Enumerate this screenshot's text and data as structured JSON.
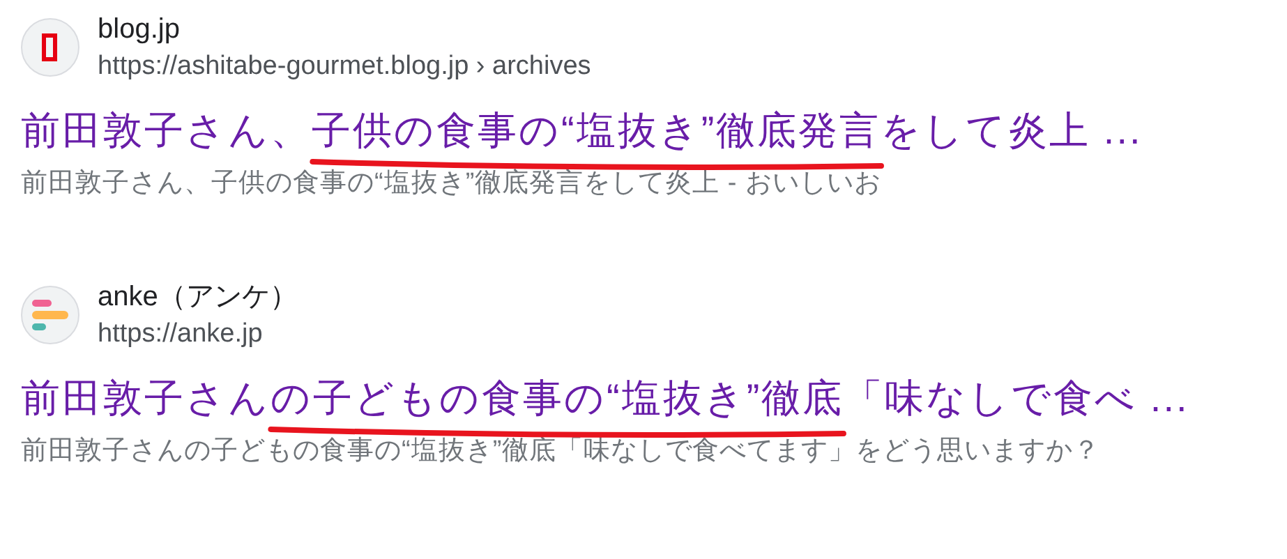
{
  "results": [
    {
      "site_name": "blog.jp",
      "url": "https://ashitabe-gourmet.blog.jp › archives",
      "title_parts": [
        {
          "text": "前田敦子さん、",
          "underlined": false
        },
        {
          "text": "子供の食事の“塩抜き”徹底発言",
          "underlined": true
        },
        {
          "text": "をして炎上 ...",
          "underlined": false
        }
      ],
      "snippet": "前田敦子さん、子供の食事の“塩抜き”徹底発言をして炎上 - おいしいお"
    },
    {
      "site_name": "anke（アンケ）",
      "url": "https://anke.jp",
      "title_parts": [
        {
          "text": "前田敦子さん",
          "underlined": false
        },
        {
          "text": "の子どもの食事の“塩抜き”徹底",
          "underlined": true
        },
        {
          "text": "「味なしで食べ ...",
          "underlined": false
        }
      ],
      "snippet": "前田敦子さんの子どもの食事の“塩抜き”徹底「味なしで食べてます」をどう思いますか？"
    }
  ]
}
